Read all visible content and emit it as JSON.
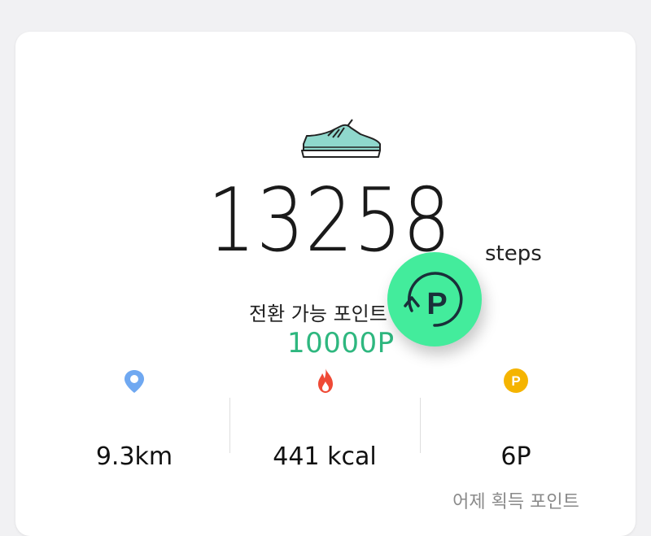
{
  "steps": {
    "count": "13258",
    "unit": "steps"
  },
  "points": {
    "label": "전환 가능 포인트",
    "value": "10000P"
  },
  "convert_button": {
    "icon": "convert-points-icon",
    "letter": "P",
    "color": "#43ec9c"
  },
  "stats": [
    {
      "icon": "location-pin-icon",
      "value": "9.3km",
      "color": "#6fa8f1"
    },
    {
      "icon": "flame-icon",
      "value": "441 kcal",
      "color": "#ef4a36"
    },
    {
      "icon": "point-coin-icon",
      "value": "6P",
      "sub": "어제 획득 포인트",
      "color": "#f5b400",
      "letter": "P"
    }
  ],
  "colors": {
    "accent_green": "#2eb77f",
    "background": "#f1f1f3",
    "card": "#ffffff"
  }
}
